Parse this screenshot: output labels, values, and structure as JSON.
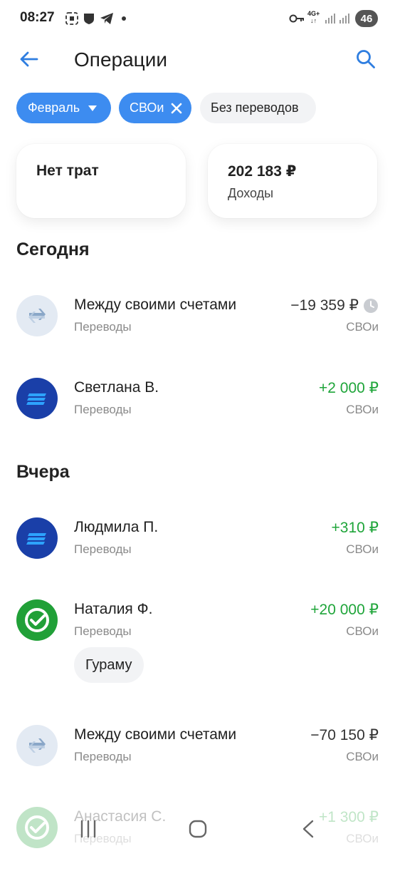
{
  "status_bar": {
    "time": "08:27",
    "network": "4G+",
    "battery": "46"
  },
  "header": {
    "title": "Операции"
  },
  "filters": {
    "month": "Февраль",
    "account": "СВОи",
    "no_transfers": "Без переводов"
  },
  "summary": {
    "expenses": "Нет трат",
    "income_amount": "202 183 ₽",
    "income_label": "Доходы"
  },
  "sections": [
    {
      "title": "Сегодня",
      "items": [
        {
          "name": "Между своими счетами",
          "category": "Переводы",
          "amount": "−19 359 ₽",
          "account": "СВОи"
        },
        {
          "name": "Светлана В.",
          "category": "Переводы",
          "amount": "+2 000 ₽",
          "account": "СВОи"
        }
      ]
    },
    {
      "title": "Вчера",
      "items": [
        {
          "name": "Людмила П.",
          "category": "Переводы",
          "amount": "+310 ₽",
          "account": "СВОи"
        },
        {
          "name": "Наталия Ф.",
          "category": "Переводы",
          "amount": "+20 000 ₽",
          "account": "СВОи",
          "comment": "Гураму"
        },
        {
          "name": "Между своими счетами",
          "category": "Переводы",
          "amount": "−70 150 ₽",
          "account": "СВОи"
        },
        {
          "name": "Анастасия С.",
          "category": "Переводы",
          "amount": "+1 300 ₽",
          "account": "СВОи"
        }
      ]
    }
  ],
  "colors": {
    "accent": "#3d8cf0",
    "positive": "#1fa53a",
    "bank_blue": "#1a3fa8",
    "bank_green": "#21a038"
  }
}
